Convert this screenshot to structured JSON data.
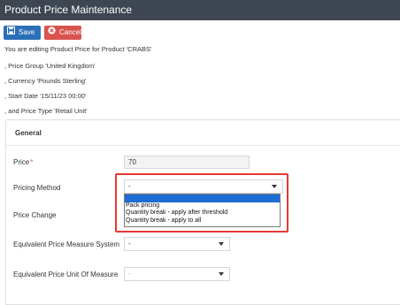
{
  "window": {
    "title": "Product Price Maintenance"
  },
  "toolbar": {
    "save_label": "Save",
    "cancel_label": "Cancel"
  },
  "info": {
    "line1": "You are editing Product Price for Product 'CRABS'",
    "line2": ", Price Group 'United Kingdom'",
    "line3": ", Currency 'Pounds Sterling'",
    "line4": ", Start Date '15/11/23 00:00'",
    "line5": ", and Price Type 'Retail Unit'"
  },
  "section": {
    "title": "General"
  },
  "form": {
    "price_label": "Price",
    "price_required_mark": "*",
    "price_value": "70",
    "pricing_method_label": "Pricing Method",
    "pricing_method_value": "-",
    "price_change_label": "Price Change",
    "eq_measure_system_label": "Equivalent Price Measure System",
    "eq_measure_system_value": "-",
    "eq_unit_label": "Equivalent Price Unit Of Measure",
    "eq_unit_value": "-"
  },
  "dropdown": {
    "options": [
      "",
      "Pack pricing",
      "Quantity break - apply after threshold",
      "Quantity break - apply to all"
    ]
  },
  "colors": {
    "titlebar": "#3e4651",
    "save_button": "#2b6fb6",
    "cancel_button": "#d9534f",
    "highlight": "#e53935",
    "selected_option": "#1e6cd6"
  }
}
